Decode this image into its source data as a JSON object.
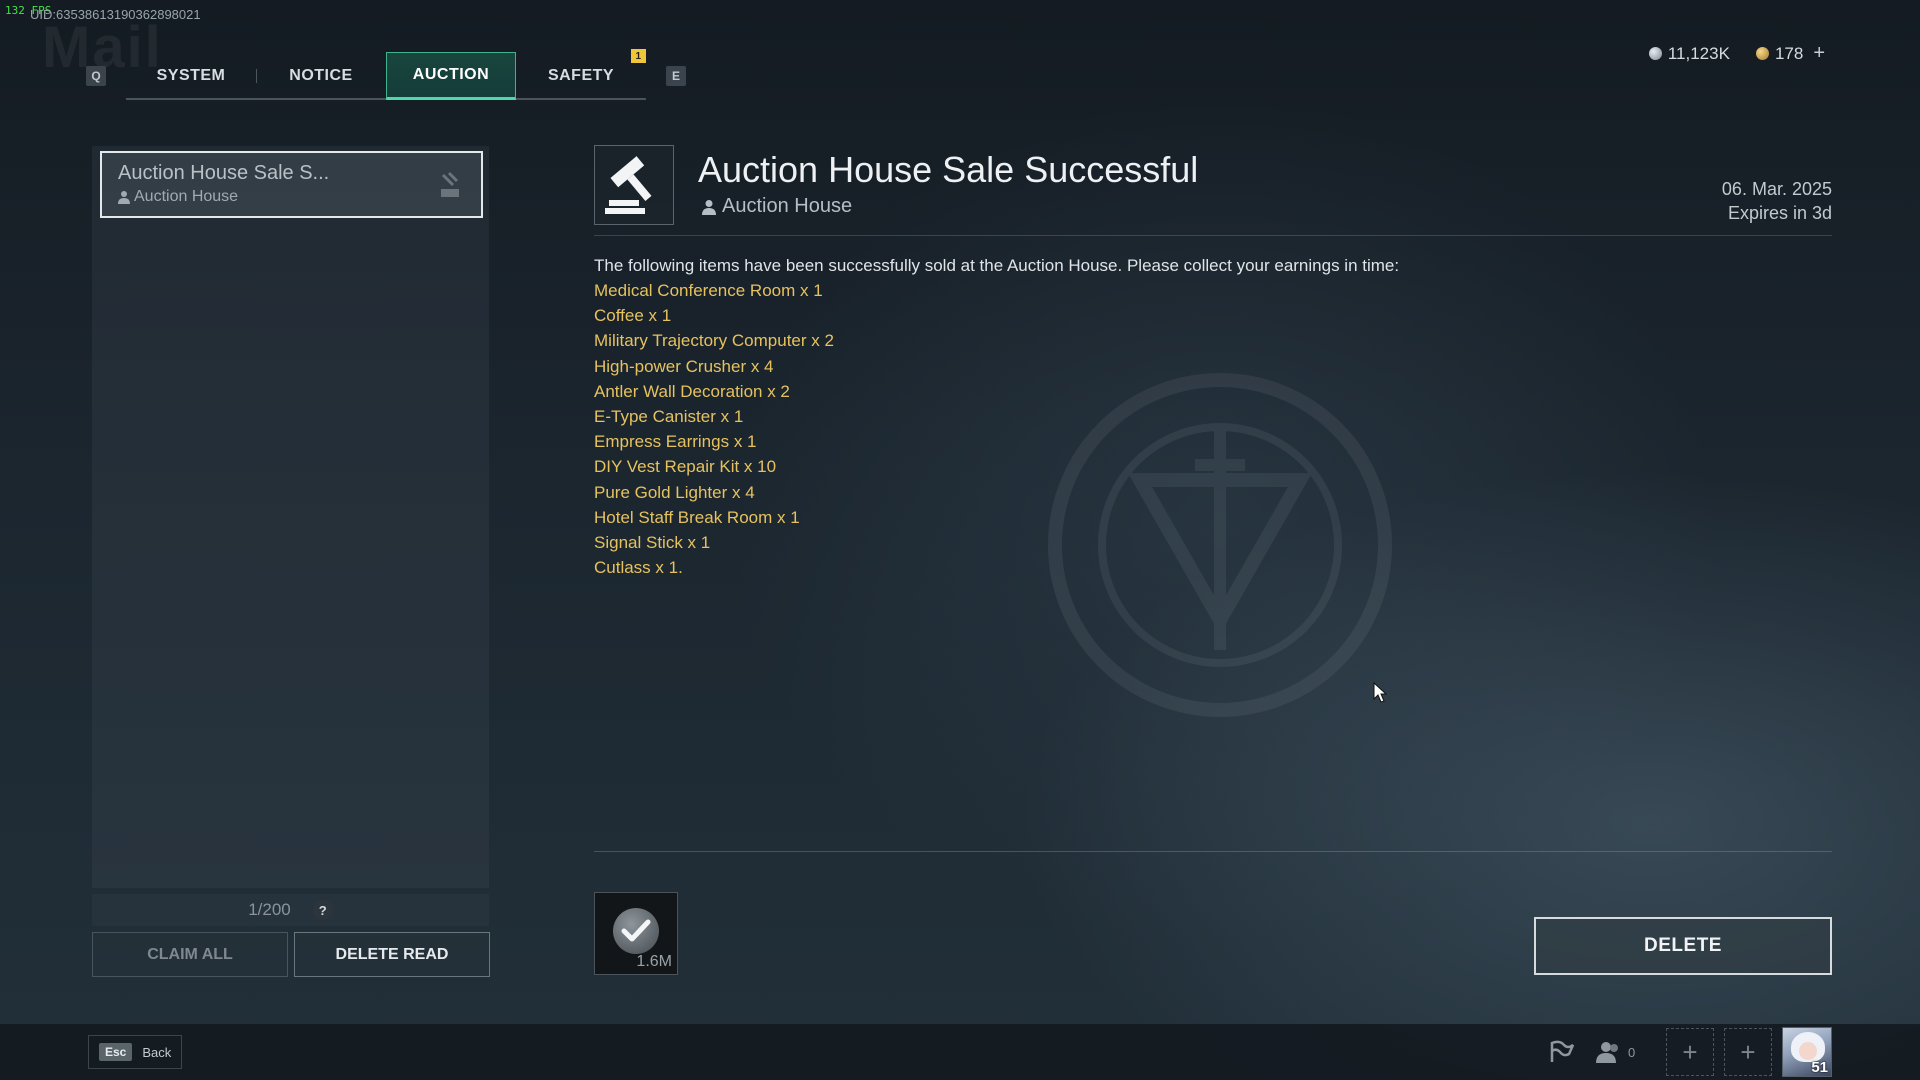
{
  "overlay": {
    "fps": "132 FPS",
    "uid": "UID:635386131903628980​21",
    "ghost_title": "Mail"
  },
  "tabs": {
    "left_key": "Q",
    "right_key": "E",
    "items": [
      {
        "label": "SYSTEM"
      },
      {
        "label": "NOTICE"
      },
      {
        "label": "AUCTION",
        "active": true
      },
      {
        "label": "SAFETY",
        "badge": "1"
      }
    ]
  },
  "currency": {
    "silver": "11,123K",
    "gold": "178",
    "add": "+"
  },
  "mail_list": {
    "items": [
      {
        "title": "Auction House Sale S...",
        "sender": "Auction House"
      }
    ],
    "counter": "1/200",
    "help": "?",
    "claim_all": "CLAIM ALL",
    "delete_read": "DELETE READ"
  },
  "detail": {
    "title": "Auction House Sale Successful",
    "sender": "Auction House",
    "date": "06. Mar. 2025",
    "expires": "Expires in 3d",
    "intro": "The following items have been successfully sold at the Auction House. Please collect your earnings in time:",
    "items": [
      "Medical Conference Room x 1",
      "Coffee x 1",
      "Military Trajectory Computer x 2",
      "High-power Crusher x 4",
      "Antler Wall Decoration x 2",
      "E-Type Canister x 1",
      "Empress Earrings x 1",
      "DIY Vest Repair Kit x 10",
      "Pure Gold Lighter x 4",
      "Hotel Staff Break Room x 1",
      "Signal Stick x 1",
      "Cutlass x 1."
    ],
    "attachment_amount": "1.6M",
    "delete_label": "DELETE"
  },
  "bottom": {
    "esc_key": "Esc",
    "back_label": "Back",
    "friends_count": "0",
    "level": "51"
  },
  "colors": {
    "accent_green": "#4fd8a8",
    "item_gold": "#e6c25f",
    "badge_yellow": "#f0c53a"
  }
}
